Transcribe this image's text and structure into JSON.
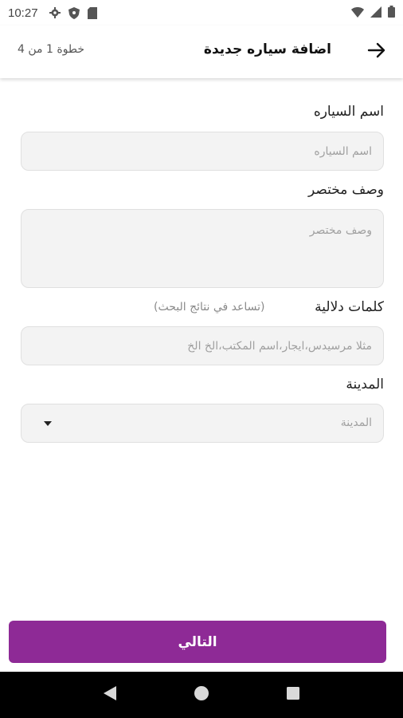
{
  "status_bar": {
    "time": "10:27",
    "icons_left": [
      "gear-icon",
      "shield-icon",
      "sd-card-icon"
    ],
    "icons_right": [
      "wifi-icon",
      "signal-icon",
      "battery-icon"
    ]
  },
  "app_bar": {
    "title": "اضافة سياره جديدة",
    "step": "خطوة 1 من 4",
    "back_icon": "arrow-right-icon"
  },
  "form": {
    "car_name": {
      "label": "اسم السياره",
      "placeholder": "اسم السياره",
      "value": ""
    },
    "short_description": {
      "label": "وصف مختصر",
      "placeholder": "وصف مختصر",
      "value": ""
    },
    "keywords": {
      "label": "كلمات دلالية",
      "hint": "(تساعد في نتائج البحث)",
      "placeholder": "مثلا مرسيدس،ايجار،اسم المكتب،الخ الخ",
      "value": ""
    },
    "city": {
      "label": "المدينة",
      "selected": "المدينة",
      "icon": "dropdown-caret-icon"
    }
  },
  "next_button": {
    "label": "التالي"
  },
  "colors": {
    "accent": "#8e2a96",
    "field_bg": "#f3f3f3",
    "nav_bg": "#000000"
  },
  "nav_bar": {
    "icons": [
      "back-triangle-icon",
      "home-circle-icon",
      "recents-square-icon"
    ]
  }
}
